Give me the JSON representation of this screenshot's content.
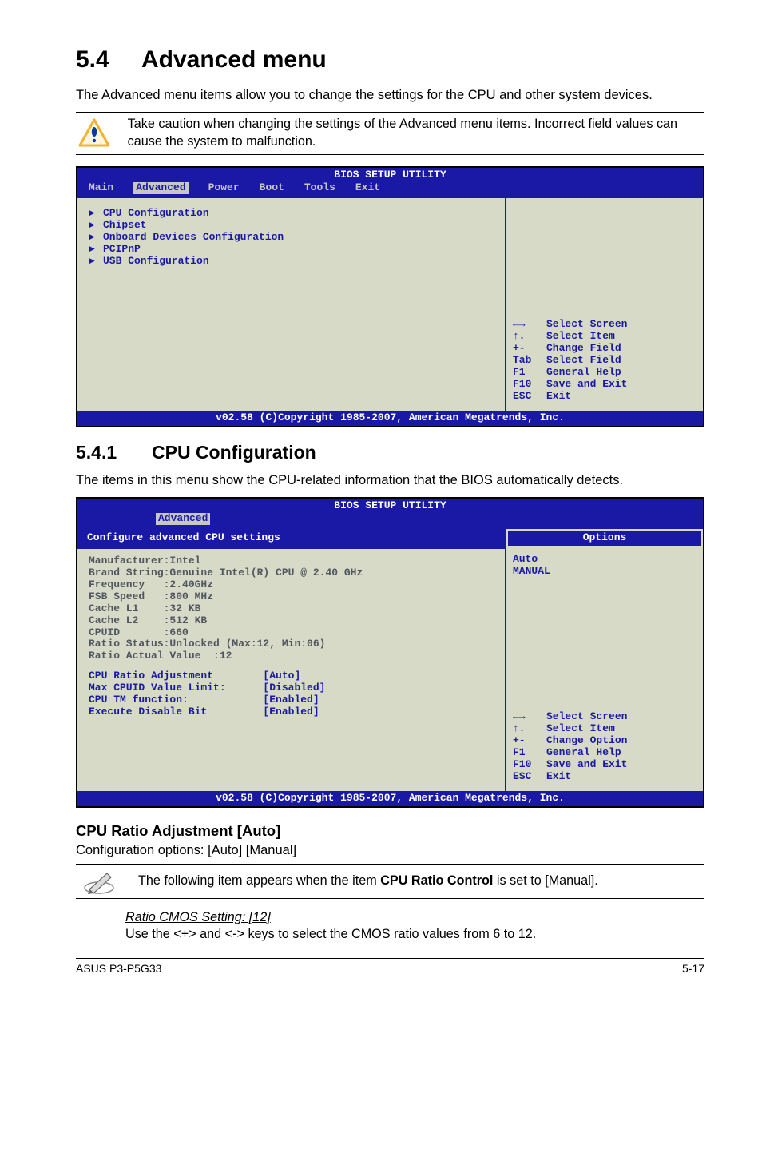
{
  "heading": {
    "num": "5.4",
    "title": "Advanced menu"
  },
  "intro": "The Advanced menu items allow you to change the settings for the CPU and other system devices.",
  "caution": "Take caution when changing the settings of the Advanced menu items. Incorrect field values can cause the system to malfunction.",
  "bios1": {
    "title": "BIOS SETUP UTILITY",
    "menus": [
      "Main",
      "Advanced",
      "Power",
      "Boot",
      "Tools",
      "Exit"
    ],
    "selected": "Advanced",
    "items": [
      "CPU Configuration",
      "Chipset",
      "Onboard Devices Configuration",
      "PCIPnP",
      "USB Configuration"
    ],
    "nav": [
      {
        "key": "←→",
        "desc": "Select Screen"
      },
      {
        "key": "↑↓",
        "desc": "Select Item"
      },
      {
        "key": "+-",
        "desc": "Change Field"
      },
      {
        "key": "Tab",
        "desc": "Select Field"
      },
      {
        "key": "F1",
        "desc": "General Help"
      },
      {
        "key": "F10",
        "desc": "Save and Exit"
      },
      {
        "key": "ESC",
        "desc": "Exit"
      }
    ],
    "footer": "v02.58 (C)Copyright 1985-2007, American Megatrends, Inc."
  },
  "sub": {
    "num": "5.4.1",
    "title": "CPU Configuration"
  },
  "sub_intro": "The items in this menu show the CPU-related information that the BIOS automatically detects.",
  "bios2": {
    "title": "BIOS SETUP UTILITY",
    "tab": "Advanced",
    "panel_title": "Configure advanced CPU settings",
    "info": [
      "Manufacturer:Intel",
      "Brand String:Genuine Intel(R) CPU @ 2.40 GHz",
      "Frequency   :2.40GHz",
      "FSB Speed   :800 MHz",
      "Cache L1    :32 KB",
      "Cache L2    :512 KB",
      "CPUID       :660",
      "Ratio Status:Unlocked (Max:12, Min:06)",
      "Ratio Actual Value  :12"
    ],
    "settings": [
      {
        "label": "CPU Ratio Adjustment",
        "value": "[Auto]"
      },
      {
        "label": "Max CPUID Value Limit:",
        "value": "[Disabled]"
      },
      {
        "label": "CPU TM function:",
        "value": "[Enabled]"
      },
      {
        "label": "Execute Disable Bit",
        "value": "[Enabled]"
      }
    ],
    "options_label": "Options",
    "options": [
      "Auto",
      "MANUAL"
    ],
    "nav": [
      {
        "key": "←→",
        "desc": "Select Screen"
      },
      {
        "key": "↑↓",
        "desc": "Select Item"
      },
      {
        "key": "+-",
        "desc": "Change Option"
      },
      {
        "key": "F1",
        "desc": "General Help"
      },
      {
        "key": "F10",
        "desc": "Save and Exit"
      },
      {
        "key": "ESC",
        "desc": "Exit"
      }
    ],
    "footer": "v02.58 (C)Copyright 1985-2007, American Megatrends, Inc."
  },
  "item1": {
    "title": "CPU Ratio Adjustment [Auto]",
    "body": "Configuration options: [Auto] [Manual]"
  },
  "note2_pre": "The following item appears when the item ",
  "note2_bold": "CPU Ratio Control",
  "note2_post": " is set to [Manual].",
  "item2": {
    "title": "Ratio CMOS Setting: [12]",
    "body": "Use the <+> and <-> keys to select the CMOS ratio values from 6 to 12."
  },
  "footer": {
    "left": "ASUS P3-P5G33",
    "right": "5-17"
  }
}
